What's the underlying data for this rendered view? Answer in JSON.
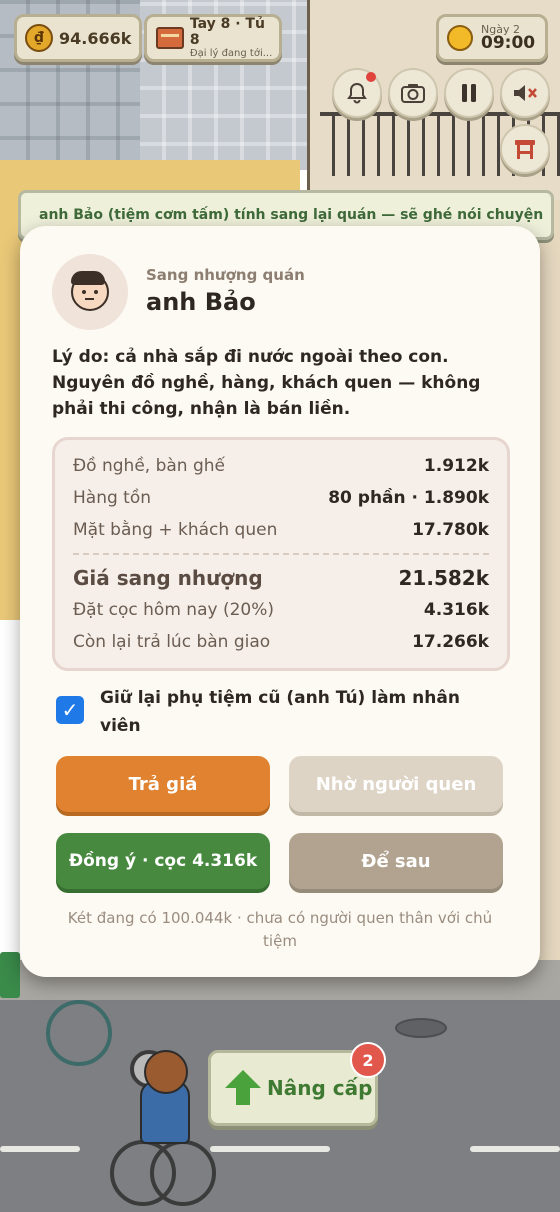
{
  "hud": {
    "coins": "94.666k",
    "table_title": "Tay 8 · Tủ 8",
    "table_sub": "Đại lý đang tới...",
    "day_label": "Ngày 2",
    "time": "09:00"
  },
  "ticker": "anh Bảo (tiệm cơm tấm) tính sang lại quán — sẽ ghé nói chuyện",
  "modal": {
    "subtitle": "Sang nhượng quán",
    "title": "anh Bảo",
    "reason": "Lý do: cả nhà sắp đi nước ngoài theo con. Nguyên đồ nghề, hàng, khách quen — không phải thi công, nhận là bán liền.",
    "rows": [
      {
        "label": "Đồ nghề, bàn ghế",
        "value": "1.912k"
      },
      {
        "label": "Hàng tồn",
        "value": "80 phần · 1.890k"
      },
      {
        "label": "Mặt bằng + khách quen",
        "value": "17.780k"
      },
      {
        "label": "Giá sang nhượng",
        "value": "21.582k"
      },
      {
        "label": "Đặt cọc hôm nay (20%)",
        "value": "4.316k"
      },
      {
        "label": "Còn lại trả lúc bàn giao",
        "value": "17.266k"
      }
    ],
    "keep_staff_label": "Giữ lại phụ tiệm cũ (anh Tú) làm nhân viên",
    "keep_staff_checked": true,
    "buttons": {
      "offer": "Trả giá",
      "ask_friend": "Nhờ người quen",
      "agree": "Đồng ý · cọc 4.316k",
      "later": "Để sau"
    },
    "footer": "Két đang có 100.044k · chưa có người quen thân với chủ tiệm"
  },
  "upgrade": {
    "label": "Nâng cấp",
    "badge": "2"
  },
  "colors": {
    "accent_orange": "#e0822f",
    "accent_green": "#47893f",
    "checkbox_blue": "#1f7ae8",
    "badge_red": "#e2574b"
  }
}
